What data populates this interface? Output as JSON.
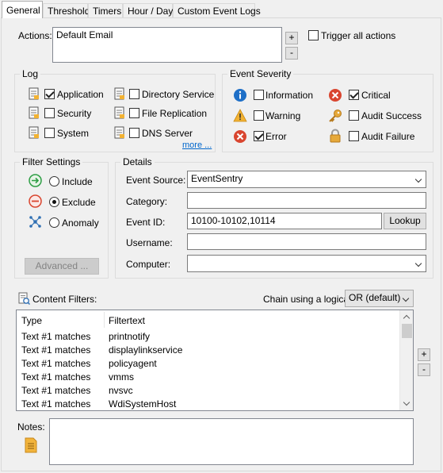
{
  "tabs": [
    {
      "label": "General",
      "active": true
    },
    {
      "label": "Threshold"
    },
    {
      "label": "Timers"
    },
    {
      "label": "Hour / Day"
    },
    {
      "label": "Custom Event Logs"
    }
  ],
  "actions": {
    "label": "Actions:",
    "value": "Default Email",
    "add": "+",
    "remove": "-",
    "trigger_all_label": "Trigger all actions",
    "trigger_all_checked": false
  },
  "log": {
    "title": "Log",
    "items": [
      {
        "label": "Application",
        "checked": true
      },
      {
        "label": "Security",
        "checked": false
      },
      {
        "label": "System",
        "checked": false
      },
      {
        "label": "Directory Service",
        "checked": false
      },
      {
        "label": "File Replication",
        "checked": false
      },
      {
        "label": "DNS Server",
        "checked": false
      }
    ],
    "more": "more ..."
  },
  "severity": {
    "title": "Event Severity",
    "items": [
      {
        "label": "Information",
        "checked": false,
        "icon": "info-icon"
      },
      {
        "label": "Warning",
        "checked": false,
        "icon": "warning-icon"
      },
      {
        "label": "Error",
        "checked": true,
        "icon": "error-icon"
      },
      {
        "label": "Critical",
        "checked": true,
        "icon": "critical-icon"
      },
      {
        "label": "Audit Success",
        "checked": false,
        "icon": "key-icon"
      },
      {
        "label": "Audit Failure",
        "checked": false,
        "icon": "lock-icon"
      }
    ]
  },
  "filter": {
    "title": "Filter Settings",
    "options": [
      {
        "label": "Include",
        "checked": false
      },
      {
        "label": "Exclude",
        "checked": true
      },
      {
        "label": "Anomaly",
        "checked": false
      }
    ],
    "advanced": "Advanced ..."
  },
  "details": {
    "title": "Details",
    "event_source_label": "Event Source:",
    "event_source_value": "EventSentry",
    "category_label": "Category:",
    "category_value": "",
    "event_id_label": "Event ID:",
    "event_id_value": "10100-10102,10114",
    "lookup": "Lookup",
    "username_label": "Username:",
    "username_value": "",
    "computer_label": "Computer:",
    "computer_value": ""
  },
  "content": {
    "label": "Content Filters:",
    "chain_label": "Chain using a logical",
    "chain_value": "OR (default)",
    "columns": [
      "Type",
      "Filtertext"
    ],
    "rows": [
      [
        "Text #1 matches",
        "printnotify"
      ],
      [
        "Text #1 matches",
        "displaylinkservice"
      ],
      [
        "Text #1 matches",
        "policyagent"
      ],
      [
        "Text #1 matches",
        "vmms"
      ],
      [
        "Text #1 matches",
        "nvsvc"
      ],
      [
        "Text #1 matches",
        "WdiSystemHost"
      ]
    ],
    "add": "+",
    "remove": "-"
  },
  "notes": {
    "label": "Notes:",
    "value": ""
  },
  "colors": {
    "accent_link": "#0066cc",
    "info": "#1e6fc7",
    "error": "#d9452f",
    "warning": "#f2b233"
  }
}
